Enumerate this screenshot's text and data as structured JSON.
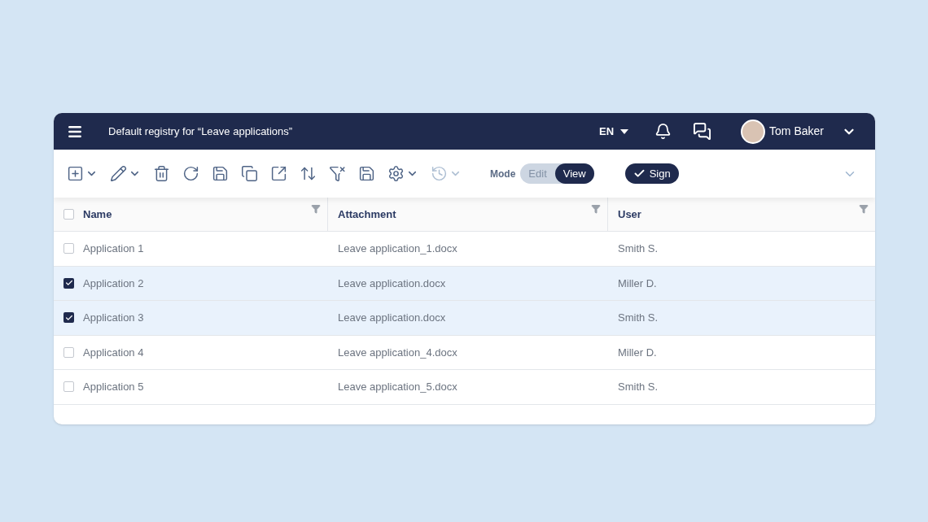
{
  "header": {
    "title": "Default registry for “Leave applications”",
    "language": "EN",
    "user": "Tom Baker"
  },
  "toolbar": {
    "tools": [
      {
        "kind": "add",
        "has_menu": true,
        "disabled": false
      },
      {
        "kind": "edit",
        "has_menu": true,
        "disabled": false
      },
      {
        "kind": "delete",
        "has_menu": false,
        "disabled": false
      },
      {
        "kind": "refresh",
        "has_menu": false,
        "disabled": false
      },
      {
        "kind": "save",
        "has_menu": false,
        "disabled": false
      },
      {
        "kind": "copy",
        "has_menu": false,
        "disabled": false
      },
      {
        "kind": "open",
        "has_menu": false,
        "disabled": false
      },
      {
        "kind": "sort",
        "has_menu": false,
        "disabled": false
      },
      {
        "kind": "clear-filter",
        "has_menu": false,
        "disabled": false
      },
      {
        "kind": "save-check",
        "has_menu": false,
        "disabled": false
      },
      {
        "kind": "settings",
        "has_menu": true,
        "disabled": false
      },
      {
        "kind": "history",
        "has_menu": true,
        "disabled": true
      }
    ],
    "mode": {
      "label": "Mode",
      "options": [
        {
          "label": "Edit",
          "selected": false
        },
        {
          "label": "View",
          "selected": true
        }
      ]
    },
    "sign_button": "Sign"
  },
  "table": {
    "all_checked": false,
    "columns": [
      {
        "label": "Name"
      },
      {
        "label": "Attachment"
      },
      {
        "label": "User"
      }
    ],
    "rows": [
      {
        "selected": false,
        "cells": [
          "Application 1",
          "Leave application_1.docx",
          "Smith S."
        ]
      },
      {
        "selected": true,
        "cells": [
          "Application 2",
          "Leave application.docx",
          "Miller D."
        ]
      },
      {
        "selected": true,
        "cells": [
          "Application 3",
          "Leave application.docx",
          "Smith S."
        ]
      },
      {
        "selected": false,
        "cells": [
          "Application 4",
          "Leave application_4.docx",
          "Miller D."
        ]
      },
      {
        "selected": false,
        "cells": [
          "Application 5",
          "Leave application_5.docx",
          "Smith S."
        ]
      }
    ]
  }
}
